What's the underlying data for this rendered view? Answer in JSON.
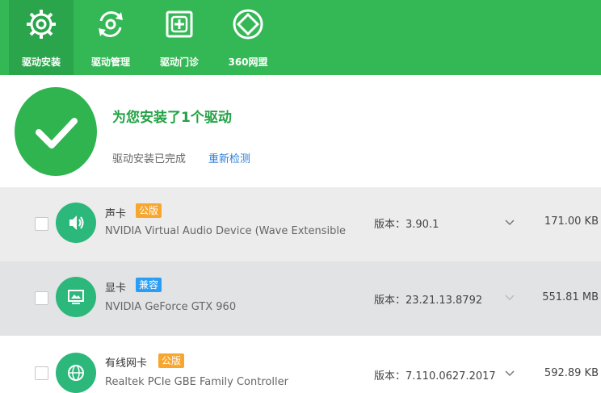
{
  "toolbar": {
    "tabs": [
      {
        "label": "驱动安装",
        "icon": "gear-icon",
        "active": true
      },
      {
        "label": "驱动管理",
        "icon": "refresh-icon",
        "active": false
      },
      {
        "label": "驱动门诊",
        "icon": "medical-kit-icon",
        "active": false
      },
      {
        "label": "360网盟",
        "icon": "network-diamond-icon",
        "active": false
      }
    ]
  },
  "status": {
    "headline": "为您安装了1个驱动",
    "subline": "驱动安装已完成",
    "recheck_label": "重新检测"
  },
  "drivers": [
    {
      "category": "声卡",
      "badge": "公版",
      "badge_color": "#f7a630",
      "description": "NVIDIA Virtual Audio Device (Wave Extensible",
      "version": "版本：3.90.1",
      "size": "171.00 KB",
      "icon": "speaker-icon"
    },
    {
      "category": "显卡",
      "badge": "兼容",
      "badge_color": "#2a9df4",
      "description": "NVIDIA GeForce GTX 960",
      "version": "版本：23.21.13.8792",
      "size": "551.81 MB",
      "icon": "monitor-icon"
    },
    {
      "category": "有线网卡",
      "badge": "公版",
      "badge_color": "#f7a630",
      "description": "Realtek PCIe GBE Family Controller",
      "version": "版本：7.110.0627.2017",
      "size": "592.89 KB",
      "icon": "globe-icon"
    }
  ],
  "colors": {
    "brand_green": "#33b855",
    "success_green": "#2fb44f",
    "link_blue": "#2f7ed8"
  }
}
